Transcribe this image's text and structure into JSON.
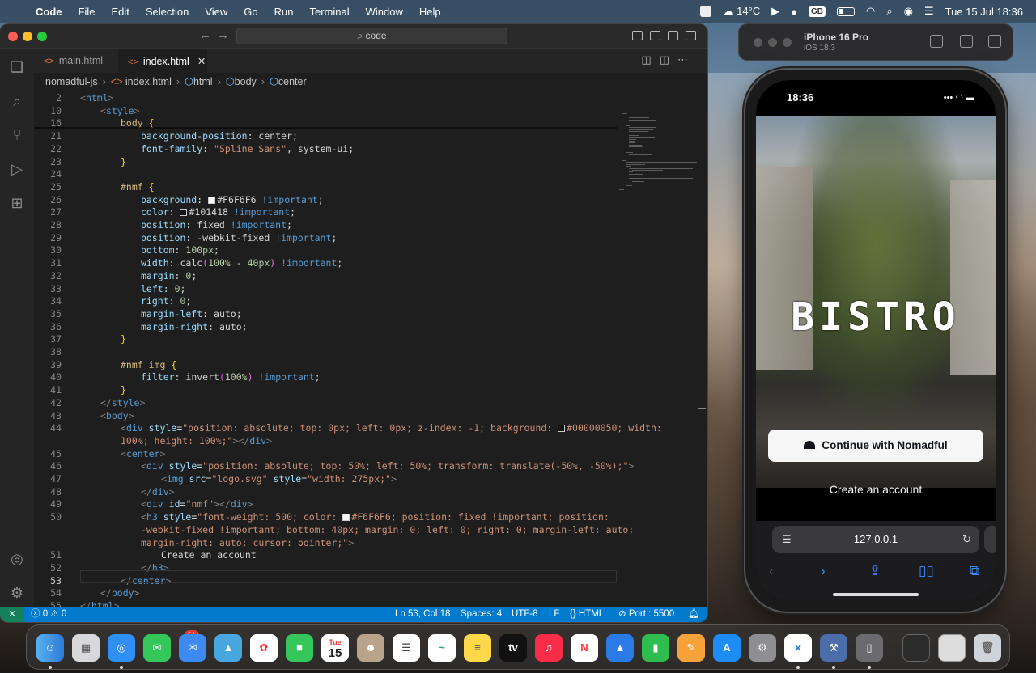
{
  "menubar": {
    "app": "Code",
    "items": [
      "File",
      "Edit",
      "Selection",
      "View",
      "Go",
      "Run",
      "Terminal",
      "Window",
      "Help"
    ],
    "weather": "14°C",
    "lang": "GB",
    "datetime": "Tue 15 Jul  18:36"
  },
  "vscode": {
    "search": "code",
    "tabs": [
      {
        "label": "main.html",
        "active": false
      },
      {
        "label": "index.html",
        "active": true
      }
    ],
    "breadcrumb": [
      "nomadful-js",
      "index.html",
      "html",
      "body",
      "center"
    ],
    "lines": [
      {
        "n": "2",
        "segs": [
          [
            "ang",
            "<"
          ],
          [
            "tag",
            "html"
          ],
          [
            "ang",
            ">"
          ]
        ],
        "ind": 0
      },
      {
        "n": "10",
        "segs": [
          [
            "ang",
            "<"
          ],
          [
            "tag",
            "style"
          ],
          [
            "ang",
            ">"
          ]
        ],
        "ind": 1
      },
      {
        "n": "16",
        "segs": [
          [
            "sel",
            "body"
          ],
          [
            "white",
            " "
          ],
          [
            "brace",
            "{"
          ]
        ],
        "ind": 2
      },
      {
        "n": "21",
        "segs": [
          [
            "prop",
            "background-position"
          ],
          [
            "white",
            ": center;"
          ]
        ],
        "ind": 3
      },
      {
        "n": "22",
        "segs": [
          [
            "prop",
            "font-family"
          ],
          [
            "white",
            ": "
          ],
          [
            "str",
            "\"Spline Sans\""
          ],
          [
            "white",
            ", system-ui;"
          ]
        ],
        "ind": 3
      },
      {
        "n": "23",
        "segs": [
          [
            "brace",
            "}"
          ]
        ],
        "ind": 2
      },
      {
        "n": "24",
        "segs": [],
        "ind": 0
      },
      {
        "n": "25",
        "segs": [
          [
            "sel",
            "#nmf"
          ],
          [
            "white",
            " "
          ],
          [
            "brace",
            "{"
          ]
        ],
        "ind": 2
      },
      {
        "n": "26",
        "segs": [
          [
            "prop",
            "background"
          ],
          [
            "white",
            ": "
          ],
          [
            "sw",
            "#F6F6F6"
          ],
          [
            "white",
            "#F6F6F6 "
          ],
          [
            "kw",
            "!important"
          ],
          [
            "white",
            ";"
          ]
        ],
        "ind": 3
      },
      {
        "n": "27",
        "segs": [
          [
            "prop",
            "color"
          ],
          [
            "white",
            ": "
          ],
          [
            "sw",
            "#101418"
          ],
          [
            "white",
            "#101418 "
          ],
          [
            "kw",
            "!important"
          ],
          [
            "white",
            ";"
          ]
        ],
        "ind": 3
      },
      {
        "n": "28",
        "segs": [
          [
            "prop",
            "position"
          ],
          [
            "white",
            ": fixed "
          ],
          [
            "kw",
            "!important"
          ],
          [
            "white",
            ";"
          ]
        ],
        "ind": 3
      },
      {
        "n": "29",
        "segs": [
          [
            "prop",
            "position"
          ],
          [
            "white",
            ": -webkit-fixed "
          ],
          [
            "kw",
            "!important"
          ],
          [
            "white",
            ";"
          ]
        ],
        "ind": 3
      },
      {
        "n": "30",
        "segs": [
          [
            "prop",
            "bottom"
          ],
          [
            "white",
            ": "
          ],
          [
            "num",
            "100px"
          ],
          [
            "white",
            ";"
          ]
        ],
        "ind": 3
      },
      {
        "n": "31",
        "segs": [
          [
            "prop",
            "width"
          ],
          [
            "white",
            ": calc"
          ],
          [
            "pink",
            "("
          ],
          [
            "num",
            "100%"
          ],
          [
            "white",
            " - "
          ],
          [
            "num",
            "40px"
          ],
          [
            "pink",
            ")"
          ],
          [
            "white",
            " "
          ],
          [
            "kw",
            "!important"
          ],
          [
            "white",
            ";"
          ]
        ],
        "ind": 3
      },
      {
        "n": "32",
        "segs": [
          [
            "prop",
            "margin"
          ],
          [
            "white",
            ": "
          ],
          [
            "num",
            "0"
          ],
          [
            "white",
            ";"
          ]
        ],
        "ind": 3
      },
      {
        "n": "33",
        "segs": [
          [
            "prop",
            "left"
          ],
          [
            "white",
            ": "
          ],
          [
            "num",
            "0"
          ],
          [
            "white",
            ";"
          ]
        ],
        "ind": 3
      },
      {
        "n": "34",
        "segs": [
          [
            "prop",
            "right"
          ],
          [
            "white",
            ": "
          ],
          [
            "num",
            "0"
          ],
          [
            "white",
            ";"
          ]
        ],
        "ind": 3
      },
      {
        "n": "35",
        "segs": [
          [
            "prop",
            "margin-left"
          ],
          [
            "white",
            ": auto;"
          ]
        ],
        "ind": 3
      },
      {
        "n": "36",
        "segs": [
          [
            "prop",
            "margin-right"
          ],
          [
            "white",
            ": auto;"
          ]
        ],
        "ind": 3
      },
      {
        "n": "37",
        "segs": [
          [
            "brace",
            "}"
          ]
        ],
        "ind": 2
      },
      {
        "n": "38",
        "segs": [],
        "ind": 0
      },
      {
        "n": "39",
        "segs": [
          [
            "sel",
            "#nmf img"
          ],
          [
            "white",
            " "
          ],
          [
            "brace",
            "{"
          ]
        ],
        "ind": 2
      },
      {
        "n": "40",
        "segs": [
          [
            "prop",
            "filter"
          ],
          [
            "white",
            ": invert"
          ],
          [
            "pink",
            "("
          ],
          [
            "num",
            "100%"
          ],
          [
            "pink",
            ")"
          ],
          [
            "white",
            " "
          ],
          [
            "kw",
            "!important"
          ],
          [
            "white",
            ";"
          ]
        ],
        "ind": 3
      },
      {
        "n": "41",
        "segs": [
          [
            "brace",
            "}"
          ]
        ],
        "ind": 2
      },
      {
        "n": "42",
        "segs": [
          [
            "ang",
            "</"
          ],
          [
            "tag",
            "style"
          ],
          [
            "ang",
            ">"
          ]
        ],
        "ind": 1
      },
      {
        "n": "43",
        "segs": [
          [
            "ang",
            "<"
          ],
          [
            "tag",
            "body"
          ],
          [
            "ang",
            ">"
          ]
        ],
        "ind": 1
      },
      {
        "n": "44",
        "segs": [
          [
            "ang",
            "<"
          ],
          [
            "tag",
            "div"
          ],
          [
            "white",
            " "
          ],
          [
            "attr",
            "style"
          ],
          [
            "white",
            "="
          ],
          [
            "str",
            "\"position: absolute; top: 0px; left: 0px; z-index: -1; background: "
          ],
          [
            "sw",
            "#00000050"
          ],
          [
            "str",
            "#00000050; width:"
          ]
        ],
        "ind": 2
      },
      {
        "n": "",
        "segs": [
          [
            "str",
            "100%; height: 100%;\""
          ],
          [
            "ang",
            "></"
          ],
          [
            "tag",
            "div"
          ],
          [
            "ang",
            ">"
          ]
        ],
        "ind": 2
      },
      {
        "n": "45",
        "segs": [
          [
            "ang",
            "<"
          ],
          [
            "tag",
            "center"
          ],
          [
            "ang",
            ">"
          ]
        ],
        "ind": 2
      },
      {
        "n": "46",
        "segs": [
          [
            "ang",
            "<"
          ],
          [
            "tag",
            "div"
          ],
          [
            "white",
            " "
          ],
          [
            "attr",
            "style"
          ],
          [
            "white",
            "="
          ],
          [
            "str",
            "\"position: absolute; top: 50%; left: 50%; transform: translate(-50%, -50%);\""
          ],
          [
            "ang",
            ">"
          ]
        ],
        "ind": 3
      },
      {
        "n": "47",
        "segs": [
          [
            "ang",
            "<"
          ],
          [
            "tag",
            "img"
          ],
          [
            "white",
            " "
          ],
          [
            "attr",
            "src"
          ],
          [
            "white",
            "="
          ],
          [
            "str",
            "\"logo.svg\""
          ],
          [
            "white",
            " "
          ],
          [
            "attr",
            "style"
          ],
          [
            "white",
            "="
          ],
          [
            "str",
            "\"width: 275px;\""
          ],
          [
            "ang",
            ">"
          ]
        ],
        "ind": 4
      },
      {
        "n": "48",
        "segs": [
          [
            "ang",
            "</"
          ],
          [
            "tag",
            "div"
          ],
          [
            "ang",
            ">"
          ]
        ],
        "ind": 3
      },
      {
        "n": "49",
        "segs": [
          [
            "ang",
            "<"
          ],
          [
            "tag",
            "div"
          ],
          [
            "white",
            " "
          ],
          [
            "attr",
            "id"
          ],
          [
            "white",
            "="
          ],
          [
            "str",
            "\"nmf\""
          ],
          [
            "ang",
            "></"
          ],
          [
            "tag",
            "div"
          ],
          [
            "ang",
            ">"
          ]
        ],
        "ind": 3
      },
      {
        "n": "50",
        "segs": [
          [
            "ang",
            "<"
          ],
          [
            "tag",
            "h3"
          ],
          [
            "white",
            " "
          ],
          [
            "attr",
            "style"
          ],
          [
            "white",
            "="
          ],
          [
            "str",
            "\"font-weight: 500; color: "
          ],
          [
            "sw",
            "#F6F6F6"
          ],
          [
            "str",
            "#F6F6F6; position: fixed !important; position:"
          ]
        ],
        "ind": 3
      },
      {
        "n": "",
        "segs": [
          [
            "str",
            "-webkit-fixed !important; bottom: 40px; margin: 0; left: 0; right: 0; margin-left: auto;"
          ]
        ],
        "ind": 3
      },
      {
        "n": "",
        "segs": [
          [
            "str",
            "margin-right: auto; cursor: pointer;\""
          ],
          [
            "ang",
            ">"
          ]
        ],
        "ind": 3
      },
      {
        "n": "51",
        "segs": [
          [
            "white",
            "Create an account"
          ]
        ],
        "ind": 4
      },
      {
        "n": "52",
        "segs": [
          [
            "ang",
            "</"
          ],
          [
            "tag",
            "h3"
          ],
          [
            "ang",
            ">"
          ]
        ],
        "ind": 3
      },
      {
        "n": "53",
        "segs": [
          [
            "ang",
            "</"
          ],
          [
            "tag",
            "center"
          ],
          [
            "ang",
            ">"
          ]
        ],
        "ind": 2
      },
      {
        "n": "54",
        "segs": [
          [
            "ang",
            "</"
          ],
          [
            "tag",
            "body"
          ],
          [
            "ang",
            ">"
          ]
        ],
        "ind": 1
      },
      {
        "n": "55",
        "segs": [
          [
            "ang",
            "</"
          ],
          [
            "tag",
            "html"
          ],
          [
            "ang",
            ">"
          ]
        ],
        "ind": 0
      }
    ],
    "status": {
      "problems": "0",
      "warnings": "0",
      "position": "Ln 53, Col 18",
      "spaces": "Spaces: 4",
      "encoding": "UTF-8",
      "eol": "LF",
      "lang": "HTML",
      "port": "Port : 5500"
    }
  },
  "simulator": {
    "device": "iPhone 16 Pro",
    "os": "iOS 18.3"
  },
  "phone": {
    "time": "18:36",
    "brand": "BISTRO",
    "continue_label": "Continue with Nomadful",
    "create_label": "Create an account",
    "url": "127.0.0.1"
  },
  "dock": {
    "messages_badge": "61",
    "calendar_month": "Tue",
    "calendar_day": "15",
    "tv_label": "tv"
  }
}
